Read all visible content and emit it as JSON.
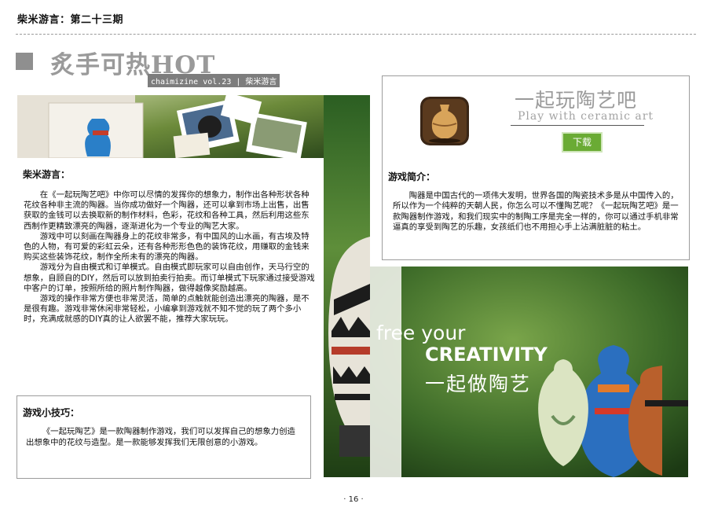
{
  "header": {
    "magazine_issue": "柴米游言：第二十三期"
  },
  "section": {
    "title": "炙手可热HOT",
    "tag": "chaimizine vol.23 | 柴米游言"
  },
  "editor_note": {
    "title": "柴米游言：",
    "paragraphs": [
      "在《一起玩陶艺吧》中你可以尽情的发挥你的想象力，制作出各种形状各种花纹各种非主流的陶器。当你成功做好一个陶器，还可以拿到市场上出售，出售获取的金钱可以去换取新的制作材料，色彩，花纹和各种工具，然后利用这些东西制作更精致漂亮的陶器，逐渐进化为一个专业的陶艺大家。",
      "游戏中可以刻画在陶器身上的花纹非常多，有中国风的山水画，有古埃及特色的人物，有可爱的彩虹云朵，还有各种形形色色的装饰花纹，用赚取的金钱来购买这些装饰花纹，制作全所未有的漂亮的陶器。",
      "游戏分为自由模式和订单模式。自由模式即玩家可以自由创作，天马行空的想象，自顾自的DIY，然后可以放到拍卖行拍卖。而订单模式下玩家通过接受游戏中客户的订单，按照所给的照片制作陶器，做得越像奖励越高。",
      "游戏的操作非常方便也非常灵活，简单的点触就能创造出漂亮的陶器，是不是很有趣。游戏非常休闲非常轻松，小编拿到游戏就不知不觉的玩了两个多小时，充满成就感的DIY真的让人欲罢不能，推荐大家玩玩。"
    ]
  },
  "tips": {
    "title": "游戏小技巧：",
    "text": "《一起玩陶艺》是一款陶器制作游戏，我们可以发挥自己的想象力创造出想象中的花纹与造型。是一款能够发挥我们无限创意的小游戏。"
  },
  "app": {
    "title": "一起玩陶艺吧",
    "subtitle": "Play with ceramic art",
    "download_label": "下载",
    "icon": "pottery-app-icon"
  },
  "intro": {
    "title": "游戏简介：",
    "text": "陶器是中国古代的一项伟大发明，世界各国的陶瓷技术多是从中国传入的，所以作为一个纯粹的天朝人民，你怎么可以不懂陶艺呢？《一起玩陶艺吧》是一款陶器制作游戏，和我们现实中的制陶工序是完全一样的，你可以通过手机非常逼真的享受到陶艺的乐趣，女孩纸们也不用担心手上沾满脏脏的粘土。"
  },
  "banner": {
    "line1": "free your",
    "line2": "CREATIVITY",
    "line3": "一起做陶艺"
  },
  "footer": {
    "page_number": "· 16 ·"
  },
  "colors": {
    "accent_green": "#6aab34",
    "title_gray": "#9a9a9a",
    "banner_green": "#2f5f24"
  }
}
